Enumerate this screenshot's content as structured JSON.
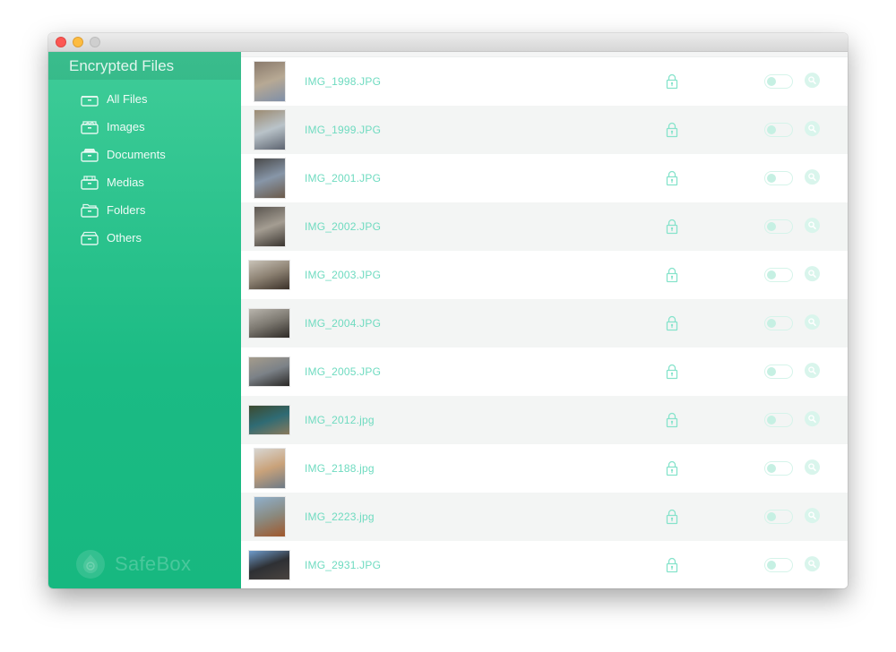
{
  "window": {
    "controls": [
      "close",
      "minimize",
      "maximize"
    ]
  },
  "sidebar": {
    "title": "Encrypted Files",
    "items": [
      {
        "label": "All Files",
        "icon": "tray-icon"
      },
      {
        "label": "Images",
        "icon": "image-tray-icon"
      },
      {
        "label": "Documents",
        "icon": "document-tray-icon"
      },
      {
        "label": "Medias",
        "icon": "media-tray-icon"
      },
      {
        "label": "Folders",
        "icon": "folder-tray-icon"
      },
      {
        "label": "Others",
        "icon": "other-tray-icon"
      }
    ],
    "brand": "SafeBox"
  },
  "files": [
    {
      "name": "IMG_1998.JPG",
      "orientation": "portrait",
      "thumb_colors": [
        "#8a7a6c",
        "#b7a994",
        "#7f8fa8"
      ],
      "locked": true,
      "toggle_on": false
    },
    {
      "name": "IMG_1999.JPG",
      "orientation": "portrait",
      "thumb_colors": [
        "#9c8b72",
        "#b9c3c9",
        "#5d6470"
      ],
      "locked": true,
      "toggle_on": false
    },
    {
      "name": "IMG_2001.JPG",
      "orientation": "portrait",
      "thumb_colors": [
        "#4a4a4a",
        "#8796a8",
        "#6b5a4a"
      ],
      "locked": true,
      "toggle_on": false
    },
    {
      "name": "IMG_2002.JPG",
      "orientation": "portrait",
      "thumb_colors": [
        "#5b5650",
        "#a49d92",
        "#3a3530"
      ],
      "locked": true,
      "toggle_on": false
    },
    {
      "name": "IMG_2003.JPG",
      "orientation": "landscape",
      "thumb_colors": [
        "#c9c3b8",
        "#8c8172",
        "#3a3028"
      ],
      "locked": true,
      "toggle_on": false
    },
    {
      "name": "IMG_2004.JPG",
      "orientation": "landscape",
      "thumb_colors": [
        "#b9b5ad",
        "#7c7870",
        "#2e2a26"
      ],
      "locked": true,
      "toggle_on": false
    },
    {
      "name": "IMG_2005.JPG",
      "orientation": "landscape",
      "thumb_colors": [
        "#a59c8c",
        "#7c8288",
        "#2a2826"
      ],
      "locked": true,
      "toggle_on": false
    },
    {
      "name": "IMG_2012.jpg",
      "orientation": "landscape",
      "thumb_colors": [
        "#3d4a2f",
        "#2f6b74",
        "#8a7a5c"
      ],
      "locked": true,
      "toggle_on": false
    },
    {
      "name": "IMG_2188.jpg",
      "orientation": "portrait",
      "thumb_colors": [
        "#d8d6d2",
        "#c9a27a",
        "#6e7a86"
      ],
      "locked": true,
      "toggle_on": false
    },
    {
      "name": "IMG_2223.jpg",
      "orientation": "portrait",
      "thumb_colors": [
        "#8fb0cc",
        "#8a8a80",
        "#a0582c"
      ],
      "locked": true,
      "toggle_on": false
    },
    {
      "name": "IMG_2931.JPG",
      "orientation": "landscape",
      "thumb_colors": [
        "#6f9ccc",
        "#2e3034",
        "#4a4440"
      ],
      "locked": true,
      "toggle_on": false
    }
  ],
  "colors": {
    "accent": "#1bbb84",
    "filename_text": "#6fdbc0",
    "row_alt": "#f3f5f4"
  }
}
